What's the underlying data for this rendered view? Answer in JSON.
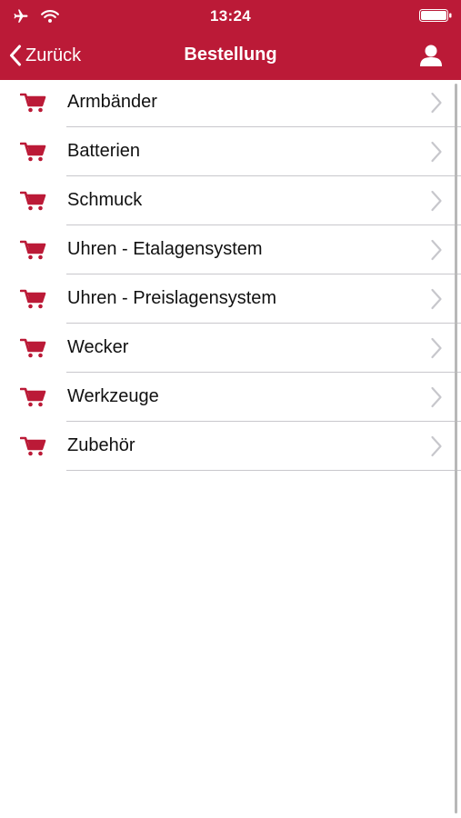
{
  "status_bar": {
    "time": "13:24",
    "left_icons": [
      "airplane-icon",
      "wifi-icon"
    ],
    "right_icons": [
      "battery-icon"
    ]
  },
  "nav": {
    "back_label": "Zurück",
    "title": "Bestellung",
    "right_icon": "user-icon"
  },
  "colors": {
    "accent": "#bb1a37",
    "separator": "#c8c7cc",
    "text": "#111111",
    "chevron": "#c7c7cc"
  },
  "list": {
    "item_icon": "shopping-cart-icon",
    "items": [
      {
        "label": "Armbänder"
      },
      {
        "label": "Batterien"
      },
      {
        "label": "Schmuck"
      },
      {
        "label": "Uhren - Etalagensystem"
      },
      {
        "label": "Uhren - Preislagensystem"
      },
      {
        "label": "Wecker"
      },
      {
        "label": "Werkzeuge"
      },
      {
        "label": "Zubehör"
      }
    ]
  }
}
